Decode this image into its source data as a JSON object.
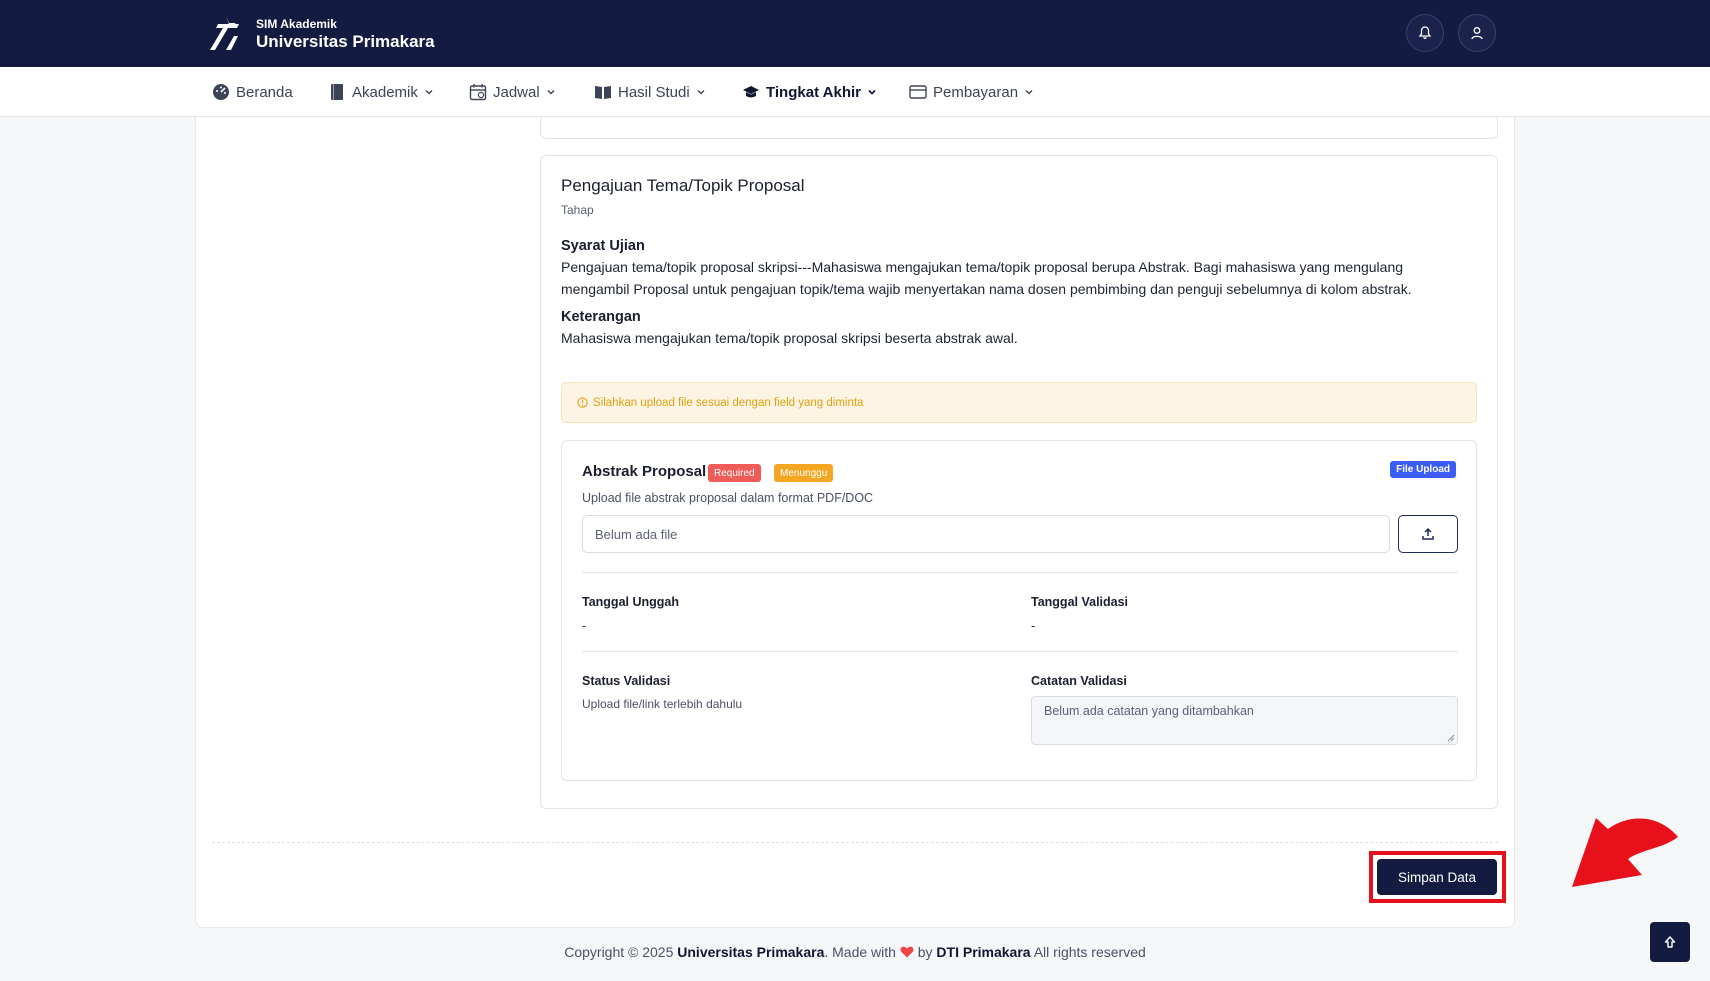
{
  "header": {
    "app_small": "SIM Akademik",
    "app_name": "Universitas Primakara"
  },
  "nav": {
    "items": [
      {
        "label": "Beranda",
        "icon": "dashboard-icon"
      },
      {
        "label": "Akademik",
        "icon": "book-icon"
      },
      {
        "label": "Jadwal",
        "icon": "calendar-icon"
      },
      {
        "label": "Hasil Studi",
        "icon": "open-book-icon"
      },
      {
        "label": "Tingkat Akhir",
        "icon": "graduation-cap-icon"
      },
      {
        "label": "Pembayaran",
        "icon": "card-icon"
      }
    ],
    "active": "Tingkat Akhir"
  },
  "step": {
    "title": "Pengajuan Tema/Topik Proposal",
    "subtitle": "Tahap",
    "requirements_heading": "Syarat Ujian",
    "requirements_text": "Pengajuan tema/topik proposal skripsi---Mahasiswa mengajukan tema/topik proposal berupa Abstrak. Bagi mahasiswa yang mengulang mengambil Proposal untuk pengajuan topik/tema wajib menyertakan nama dosen pembimbing dan penguji sebelumnya di kolom abstrak.",
    "notes_heading": "Keterangan",
    "notes_text": "Mahasiswa mengajukan tema/topik proposal skripsi beserta abstrak awal.",
    "alert": "Silahkan upload file sesuai dengan field yang diminta"
  },
  "field": {
    "title": "Abstrak Proposal",
    "badge_required": "Required",
    "badge_status": "Menunggu",
    "badge_type": "File Upload",
    "description": "Upload file abstrak proposal dalam format PDF/DOC",
    "file_placeholder": "Belum ada file",
    "upload_date_label": "Tanggal Unggah",
    "upload_date_value": "-",
    "validation_date_label": "Tanggal Validasi",
    "validation_date_value": "-",
    "validation_status_label": "Status Validasi",
    "validation_status_value": "Upload file/link terlebih dahulu",
    "validation_notes_label": "Catatan Validasi",
    "validation_notes_placeholder": "Belum ada catatan yang ditambahkan"
  },
  "actions": {
    "save_label": "Simpan Data"
  },
  "footer": {
    "copyright_prefix": "Copyright © 2025",
    "org": "Universitas Primakara",
    "made_with": ". Made with",
    "by": "by",
    "dti": "DTI Primakara",
    "rights": "All rights reserved"
  },
  "colors": {
    "navy": "#141b41",
    "alert_text": "#e2a012",
    "required": "#ef5b57",
    "waiting": "#f5a623",
    "file_upload": "#3b5df5",
    "highlight": "#e8101b"
  }
}
